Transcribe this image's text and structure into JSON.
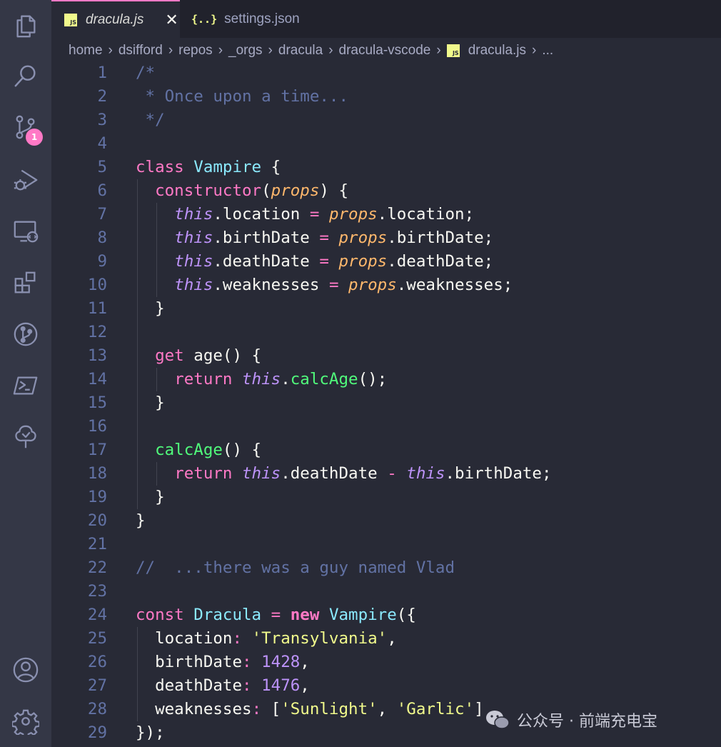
{
  "tabs": [
    {
      "label": "dracula.js",
      "icon": "js-file-icon",
      "active": true
    },
    {
      "label": "settings.json",
      "icon": "json-file-icon",
      "active": false
    }
  ],
  "breadcrumb": [
    "home",
    "dsifford",
    "repos",
    "_orgs",
    "dracula",
    "dracula-vscode",
    "dracula.js",
    "..."
  ],
  "activity_bar": {
    "top": [
      "explorer-icon",
      "search-icon",
      "source-control-icon",
      "run-debug-icon",
      "remote-explorer-icon",
      "extensions-icon",
      "git-graph-icon",
      "powershell-icon",
      "tree-icon"
    ],
    "bottom": [
      "account-icon",
      "settings-gear-icon"
    ],
    "source_control_badge": "1"
  },
  "js_badge": "JS",
  "json_icon": "{..}",
  "colors": {
    "background": "#282a36",
    "activity_bar": "#343746",
    "tab_bar": "#21222c",
    "accent": "#ff79c6"
  },
  "editor": {
    "lines": [
      [
        {
          "t": "/*",
          "c": "com"
        }
      ],
      [
        {
          "t": " * Once upon a time...",
          "c": "com"
        }
      ],
      [
        {
          "t": " */",
          "c": "com"
        }
      ],
      [],
      [
        {
          "t": "class",
          "c": "kw"
        },
        {
          "t": " "
        },
        {
          "t": "Vampire",
          "c": "cls"
        },
        {
          "t": " {"
        }
      ],
      [
        {
          "t": "  "
        },
        {
          "t": "constructor",
          "c": "kw"
        },
        {
          "t": "("
        },
        {
          "t": "props",
          "c": "par"
        },
        {
          "t": ") {"
        }
      ],
      [
        {
          "t": "    "
        },
        {
          "t": "this",
          "c": "this"
        },
        {
          "t": ".location "
        },
        {
          "t": "=",
          "c": "op"
        },
        {
          "t": " "
        },
        {
          "t": "props",
          "c": "par"
        },
        {
          "t": ".location;"
        }
      ],
      [
        {
          "t": "    "
        },
        {
          "t": "this",
          "c": "this"
        },
        {
          "t": ".birthDate "
        },
        {
          "t": "=",
          "c": "op"
        },
        {
          "t": " "
        },
        {
          "t": "props",
          "c": "par"
        },
        {
          "t": ".birthDate;"
        }
      ],
      [
        {
          "t": "    "
        },
        {
          "t": "this",
          "c": "this"
        },
        {
          "t": ".deathDate "
        },
        {
          "t": "=",
          "c": "op"
        },
        {
          "t": " "
        },
        {
          "t": "props",
          "c": "par"
        },
        {
          "t": ".deathDate;"
        }
      ],
      [
        {
          "t": "    "
        },
        {
          "t": "this",
          "c": "this"
        },
        {
          "t": ".weaknesses "
        },
        {
          "t": "=",
          "c": "op"
        },
        {
          "t": " "
        },
        {
          "t": "props",
          "c": "par"
        },
        {
          "t": ".weaknesses;"
        }
      ],
      [
        {
          "t": "  }"
        }
      ],
      [],
      [
        {
          "t": "  "
        },
        {
          "t": "get",
          "c": "kw"
        },
        {
          "t": " age() {"
        }
      ],
      [
        {
          "t": "    "
        },
        {
          "t": "return",
          "c": "kw"
        },
        {
          "t": " "
        },
        {
          "t": "this",
          "c": "this"
        },
        {
          "t": "."
        },
        {
          "t": "calcAge",
          "c": "fn"
        },
        {
          "t": "();"
        }
      ],
      [
        {
          "t": "  }"
        }
      ],
      [],
      [
        {
          "t": "  "
        },
        {
          "t": "calcAge",
          "c": "fn"
        },
        {
          "t": "() {"
        }
      ],
      [
        {
          "t": "    "
        },
        {
          "t": "return",
          "c": "kw"
        },
        {
          "t": " "
        },
        {
          "t": "this",
          "c": "this"
        },
        {
          "t": ".deathDate "
        },
        {
          "t": "-",
          "c": "op"
        },
        {
          "t": " "
        },
        {
          "t": "this",
          "c": "this"
        },
        {
          "t": ".birthDate;"
        }
      ],
      [
        {
          "t": "  }"
        }
      ],
      [
        {
          "t": "}"
        }
      ],
      [],
      [
        {
          "t": "//  ...there was a guy named Vlad",
          "c": "com"
        }
      ],
      [],
      [
        {
          "t": "const",
          "c": "kw"
        },
        {
          "t": " "
        },
        {
          "t": "Dracula",
          "c": "cls"
        },
        {
          "t": " "
        },
        {
          "t": "=",
          "c": "op"
        },
        {
          "t": " "
        },
        {
          "t": "new",
          "c": "kwb"
        },
        {
          "t": " "
        },
        {
          "t": "Vampire",
          "c": "cls"
        },
        {
          "t": "({"
        }
      ],
      [
        {
          "t": "  location"
        },
        {
          "t": ":",
          "c": "op"
        },
        {
          "t": " "
        },
        {
          "t": "'Transylvania'",
          "c": "str"
        },
        {
          "t": ","
        }
      ],
      [
        {
          "t": "  birthDate"
        },
        {
          "t": ":",
          "c": "op"
        },
        {
          "t": " "
        },
        {
          "t": "1428",
          "c": "num"
        },
        {
          "t": ","
        }
      ],
      [
        {
          "t": "  deathDate"
        },
        {
          "t": ":",
          "c": "op"
        },
        {
          "t": " "
        },
        {
          "t": "1476",
          "c": "num"
        },
        {
          "t": ","
        }
      ],
      [
        {
          "t": "  weaknesses"
        },
        {
          "t": ":",
          "c": "op"
        },
        {
          "t": " ["
        },
        {
          "t": "'Sunlight'",
          "c": "str"
        },
        {
          "t": ", "
        },
        {
          "t": "'Garlic'",
          "c": "str"
        },
        {
          "t": "]"
        }
      ],
      [
        {
          "t": "});"
        }
      ]
    ]
  },
  "watermark": "公众号 · 前端充电宝"
}
